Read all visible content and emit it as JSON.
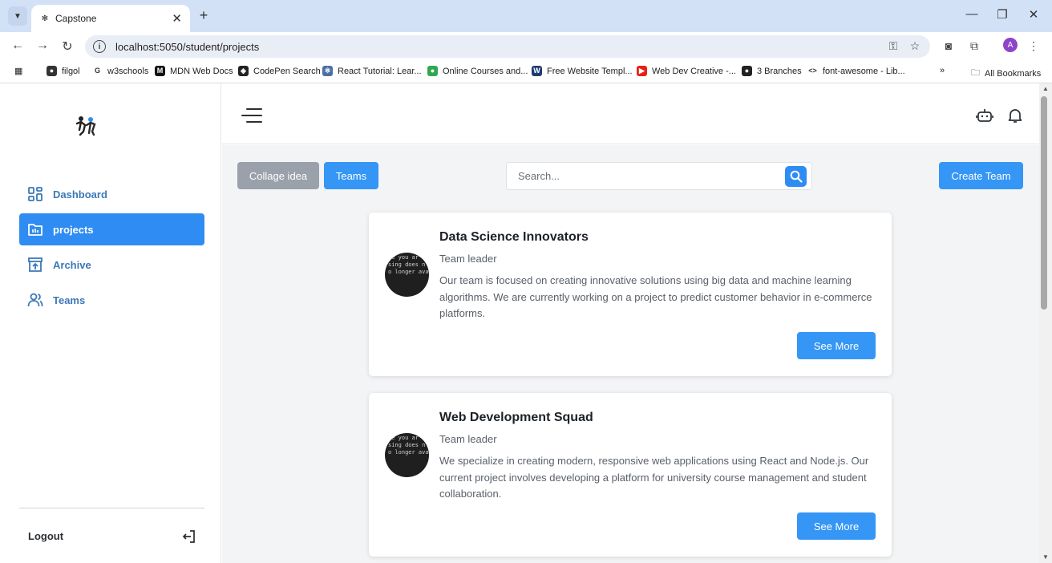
{
  "browser": {
    "tab_title": "Capstone",
    "tab_favicon": "✻",
    "url": "localhost:5050/student/projects",
    "profile_initial": "A",
    "bookmarks": [
      {
        "label": "filgol",
        "color": "#333333",
        "glyph": "●"
      },
      {
        "label": "w3schools",
        "color": "#ffffff",
        "glyph": "G"
      },
      {
        "label": "MDN Web Docs",
        "color": "#111111",
        "glyph": "M"
      },
      {
        "label": "CodePen Search",
        "color": "#222222",
        "glyph": "◈"
      },
      {
        "label": "React Tutorial: Lear...",
        "color": "#4a6fa5",
        "glyph": "⚛"
      },
      {
        "label": "Online Courses and...",
        "color": "#2fa84f",
        "glyph": "●"
      },
      {
        "label": "Free Website Templ...",
        "color": "#1f3b73",
        "glyph": "W"
      },
      {
        "label": "Web Dev Creative -...",
        "color": "#e62117",
        "glyph": "▶"
      },
      {
        "label": "3 Branches",
        "color": "#222222",
        "glyph": "●"
      },
      {
        "label": "font-awesome - Lib...",
        "color": "#ffffff",
        "glyph": "<>"
      }
    ],
    "all_bookmarks": "All Bookmarks"
  },
  "sidebar": {
    "items": [
      {
        "label": "Dashboard",
        "icon": "grid-icon",
        "active": false
      },
      {
        "label": "projects",
        "icon": "projects-icon",
        "active": true
      },
      {
        "label": "Archive",
        "icon": "archive-icon",
        "active": false
      },
      {
        "label": "Teams",
        "icon": "users-icon",
        "active": false
      }
    ],
    "logout": "Logout"
  },
  "toolbar": {
    "collage_idea": "Collage idea",
    "teams": "Teams",
    "search_placeholder": "Search...",
    "create_team": "Create Team"
  },
  "cards": [
    {
      "title": "Data Science Innovators",
      "role": "Team leader",
      "description": "Our team is focused on creating innovative solutions using big data and machine learning algorithms. We are currently working on a project to predict customer behavior in e-commerce platforms.",
      "button": "See More"
    },
    {
      "title": "Web Development Squad",
      "role": "Team leader",
      "description": "We specialize in creating modern, responsive web applications using React and Node.js. Our current project involves developing a platform for university course management and student collaboration.",
      "button": "See More"
    }
  ],
  "colors": {
    "primary": "#3596f5",
    "sidebar_text": "#3b78b6",
    "gray_button": "#9aa1aa"
  }
}
